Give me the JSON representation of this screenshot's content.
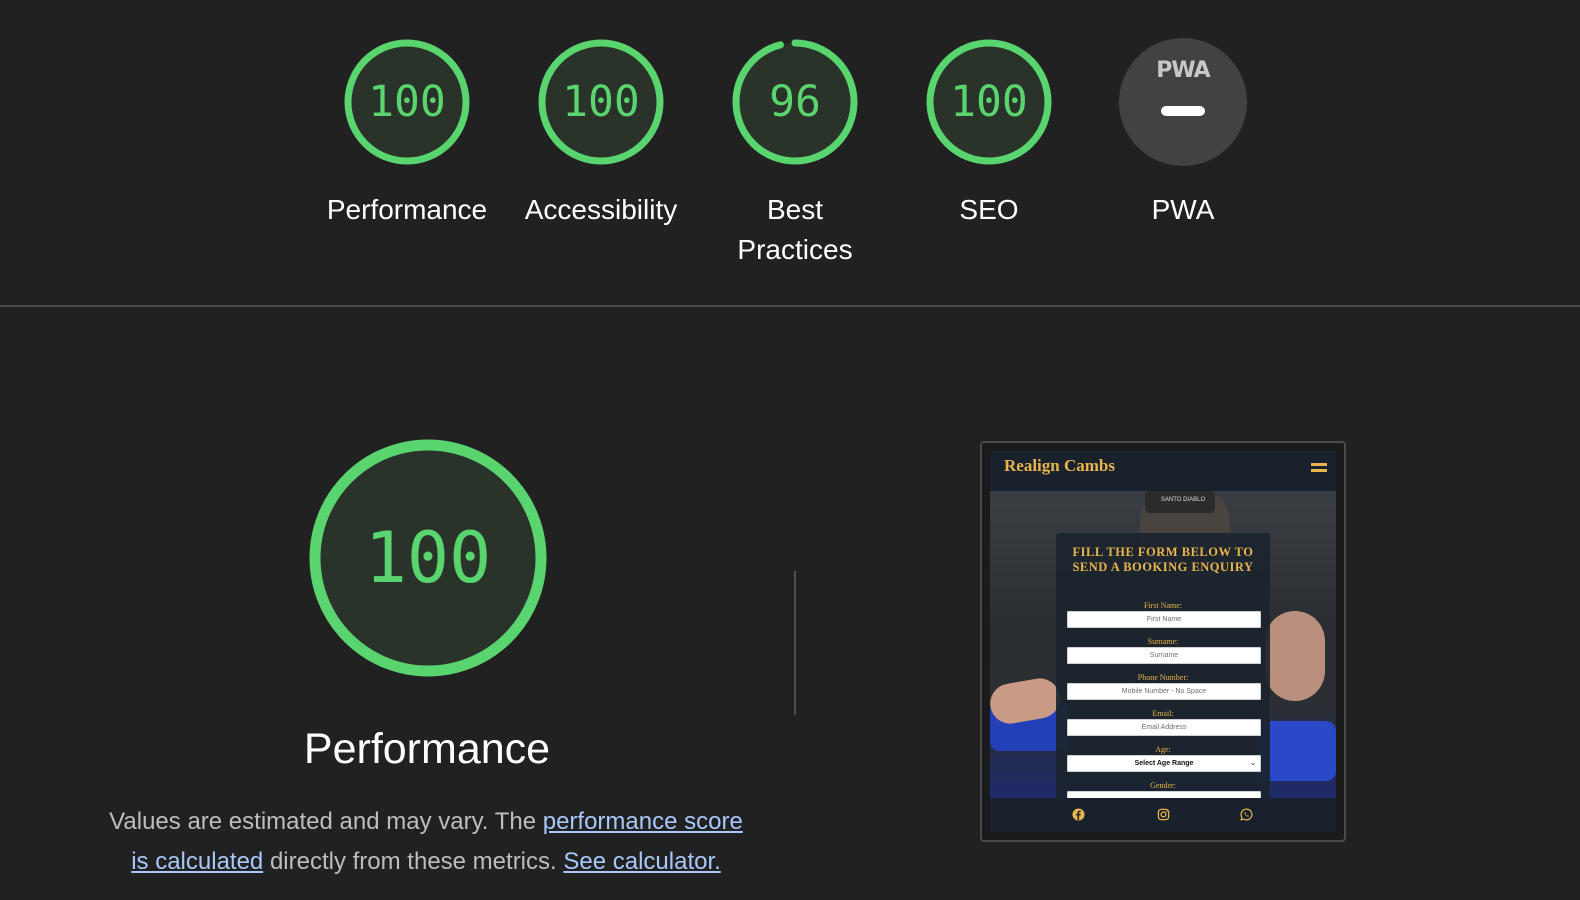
{
  "categories": [
    {
      "key": "performance",
      "score": "100",
      "fraction": 1.0,
      "label": "Performance"
    },
    {
      "key": "accessibility",
      "score": "100",
      "fraction": 1.0,
      "label": "Accessibility"
    },
    {
      "key": "best_practices",
      "score": "96",
      "fraction": 0.96,
      "label_line1": "Best",
      "label_line2": "Practices"
    },
    {
      "key": "seo",
      "score": "100",
      "fraction": 1.0,
      "label": "SEO"
    },
    {
      "key": "pwa",
      "logo_text": "PWA",
      "label": "PWA"
    }
  ],
  "performance_section": {
    "score": "100",
    "fraction": 1.0,
    "title": "Performance",
    "desc_prefix": "Values are estimated and may vary. The ",
    "link_score_calc": "performance score is calculated",
    "desc_middle": " directly from these metrics. ",
    "link_calculator": "See calculator."
  },
  "screenshot": {
    "brand": "Realign Cambs",
    "cap_text": "SANTO DIABLO",
    "form_title": "FILL THE FORM BELOW TO SEND A BOOKING ENQUIRY",
    "fields": [
      {
        "label": "First Name:",
        "placeholder": "First Name"
      },
      {
        "label": "Surname:",
        "placeholder": "Surname"
      },
      {
        "label": "Phone Number:",
        "placeholder": "Mobile Number - No Space"
      },
      {
        "label": "Email:",
        "placeholder": "Email Address"
      },
      {
        "label": "Age:",
        "value": "Select Age Range"
      },
      {
        "label": "Gender:"
      }
    ]
  },
  "colors": {
    "pass_green": "#59d46f",
    "gauge_fill": "#2a3329",
    "background": "#212121",
    "link": "#a8c7fa",
    "brand_gold": "#e9b44c"
  }
}
